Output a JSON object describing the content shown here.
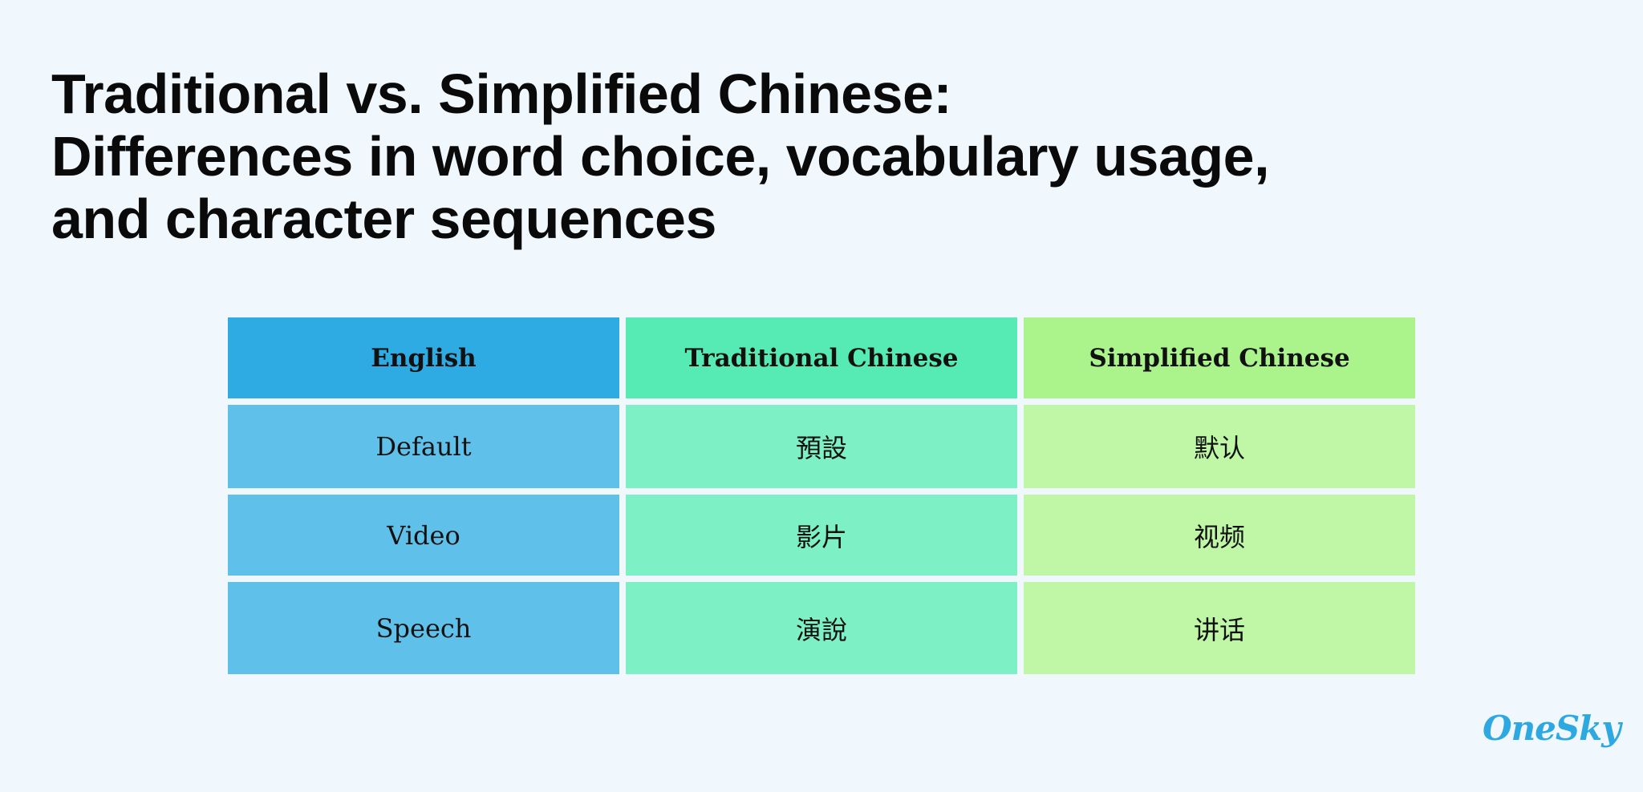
{
  "title": {
    "lines": [
      "Traditional vs. Simplified Chinese:",
      "Differences in word choice, vocabulary usage,",
      "and character sequences"
    ]
  },
  "table": {
    "headers": [
      "English",
      "Traditional Chinese",
      "Simplified Chinese"
    ],
    "rows": [
      [
        "Default",
        "預設",
        "默认"
      ],
      [
        "Video",
        "影片",
        "视频"
      ],
      [
        "Speech",
        "演說",
        "讲话"
      ]
    ]
  },
  "colors": {
    "background": "#f0f8fe",
    "english_header": "#2eabe3",
    "traditional_header": "#56ebb4",
    "simplified_header": "#aaf48b",
    "english_cell": "#5fc1ea",
    "traditional_cell": "#7df0c5",
    "simplified_cell": "#bff7a7",
    "logo": "#2ea8e0"
  },
  "logo": {
    "text": "OneSky"
  }
}
